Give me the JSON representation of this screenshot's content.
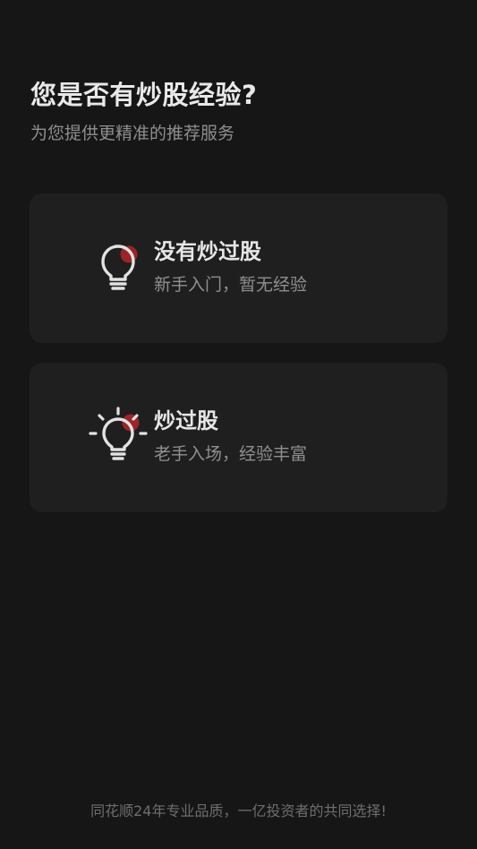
{
  "header": {
    "title": "您是否有炒股经验?",
    "subtitle": "为您提供更精准的推荐服务"
  },
  "options": [
    {
      "title": "没有炒过股",
      "description": "新手入门，暂无经验",
      "icon": "lightbulb-off-icon"
    },
    {
      "title": "炒过股",
      "description": "老手入场，经验丰富",
      "icon": "lightbulb-on-icon"
    }
  ],
  "footer": {
    "text": "同花顺24年专业品质，一亿投资者的共同选择!"
  },
  "colors": {
    "background": "#161616",
    "card": "#1f1f1f",
    "accent_red": "#b3262b",
    "text_primary": "#e6e6e6",
    "text_secondary": "#8f8f8f"
  }
}
